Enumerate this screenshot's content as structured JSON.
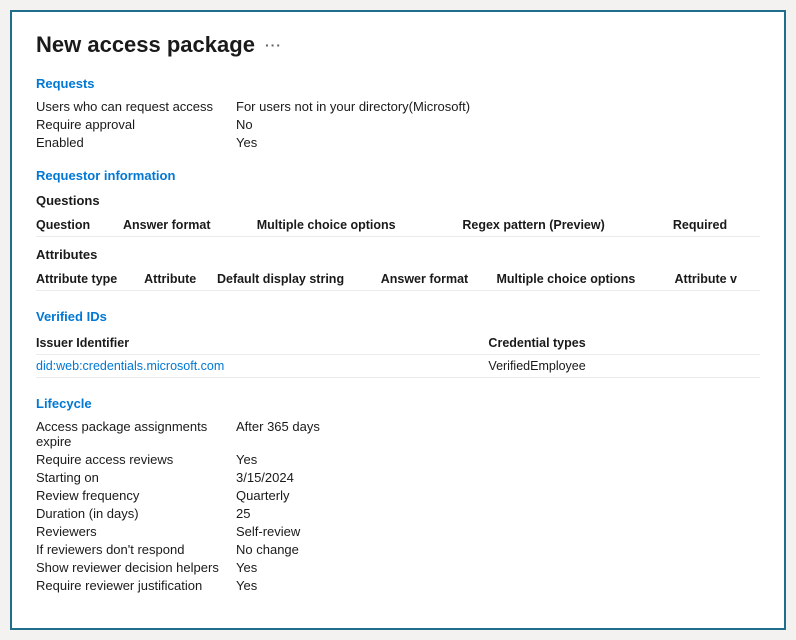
{
  "page": {
    "title": "New access package",
    "ellipsis": "···"
  },
  "requests": {
    "section_title": "Requests",
    "fields": [
      {
        "label": "Users who can request access",
        "value": "For users not in your directory(Microsoft)"
      },
      {
        "label": "Require approval",
        "value": "No"
      },
      {
        "label": "Enabled",
        "value": "Yes"
      }
    ]
  },
  "requestor_info": {
    "section_title": "Requestor information",
    "questions": {
      "subsection_title": "Questions",
      "columns": [
        "Question",
        "Answer format",
        "Multiple choice options",
        "Regex pattern (Preview)",
        "Required"
      ],
      "rows": []
    },
    "attributes": {
      "subsection_title": "Attributes",
      "columns": [
        "Attribute type",
        "Attribute",
        "Default display string",
        "Answer format",
        "Multiple choice options",
        "Attribute v"
      ],
      "rows": []
    }
  },
  "verified_ids": {
    "section_title": "Verified IDs",
    "columns": [
      "Issuer Identifier",
      "Credential types"
    ],
    "rows": [
      {
        "issuer": "did:web:credentials.microsoft.com",
        "credential": "VerifiedEmployee"
      }
    ]
  },
  "lifecycle": {
    "section_title": "Lifecycle",
    "fields": [
      {
        "label": "Access package assignments expire",
        "value": "After 365 days"
      },
      {
        "label": "Require access reviews",
        "value": "Yes"
      },
      {
        "label": "Starting on",
        "value": "3/15/2024"
      },
      {
        "label": "Review frequency",
        "value": "Quarterly"
      },
      {
        "label": "Duration (in days)",
        "value": "25"
      },
      {
        "label": "Reviewers",
        "value": "Self-review"
      },
      {
        "label": "If reviewers don't respond",
        "value": "No change"
      },
      {
        "label": "Show reviewer decision helpers",
        "value": "Yes"
      },
      {
        "label": "Require reviewer justification",
        "value": "Yes"
      }
    ]
  }
}
